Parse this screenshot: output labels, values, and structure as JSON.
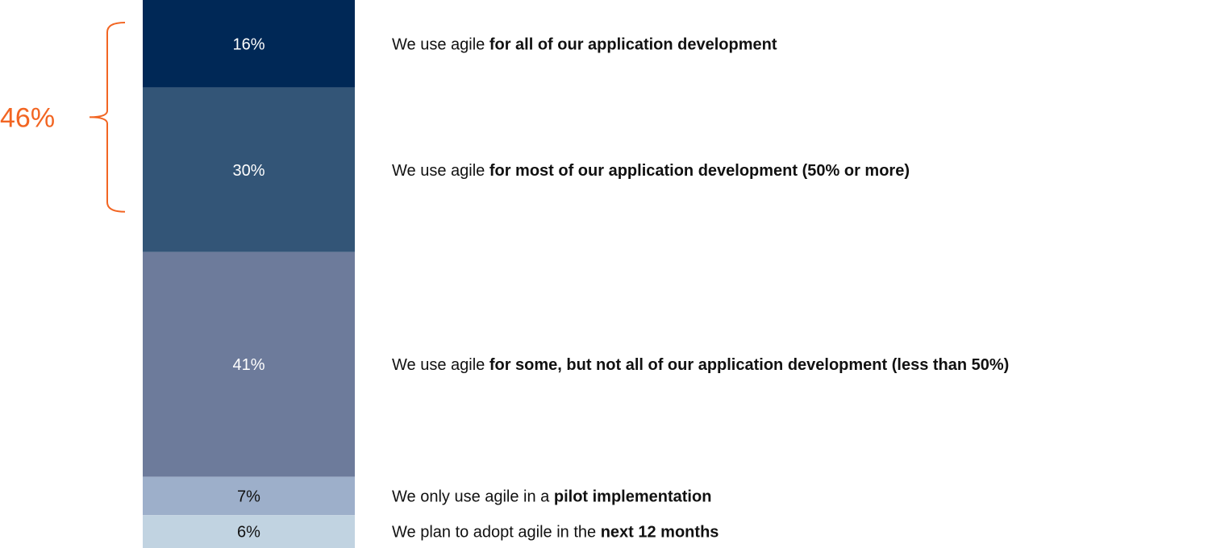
{
  "chart_data": {
    "type": "bar",
    "stacked": true,
    "orientation": "vertical",
    "series": [
      {
        "value": 16,
        "label": "16%",
        "color": "#002856",
        "text_color": "#ffffff",
        "desc_plain": "We use agile ",
        "desc_bold": "for all of our application development"
      },
      {
        "value": 30,
        "label": "30%",
        "color": "#335577",
        "text_color": "#ffffff",
        "desc_plain": "We use agile ",
        "desc_bold": "for most of our application development (50% or more)"
      },
      {
        "value": 41,
        "label": "41%",
        "color": "#6d7b9b",
        "text_color": "#ffffff",
        "desc_plain": "We use agile ",
        "desc_bold": "for some, but not all of our application development (less than 50%)"
      },
      {
        "value": 7,
        "label": "7%",
        "color": "#9dafca",
        "text_color": "#111111",
        "desc_plain": "We only use agile in a ",
        "desc_bold": "pilot implementation"
      },
      {
        "value": 6,
        "label": "6%",
        "color": "#c1d3e1",
        "text_color": "#111111",
        "desc_plain": "We plan to adopt agile in the ",
        "desc_bold": "next 12 months"
      }
    ],
    "bracket": {
      "label": "46%",
      "spans_series": [
        0,
        1
      ],
      "color": "#f26522"
    },
    "total": 100,
    "legend": "right"
  }
}
